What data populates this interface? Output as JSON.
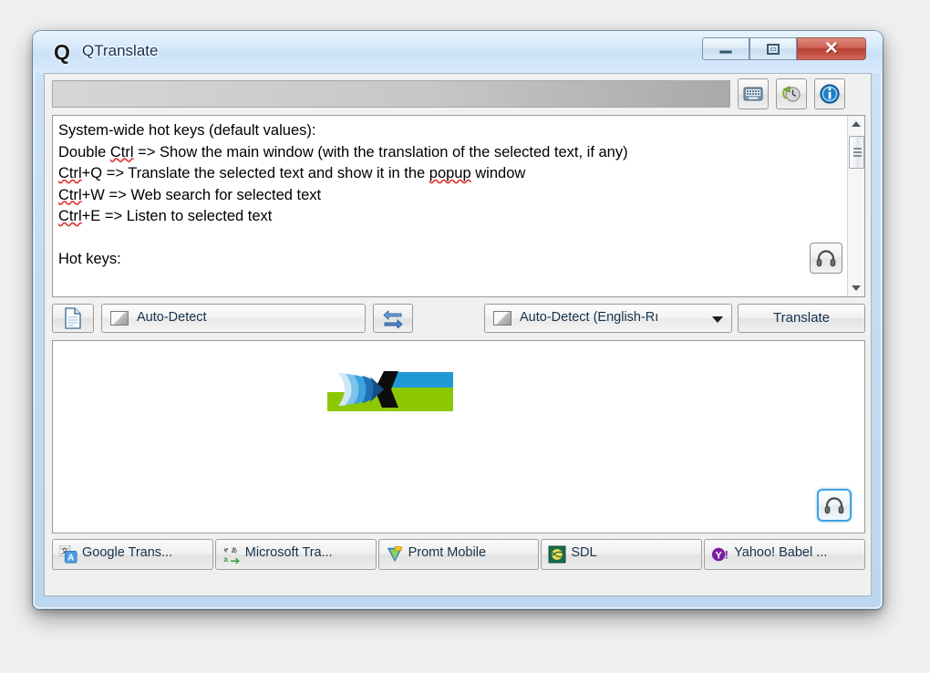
{
  "window": {
    "title": "QTranslate",
    "logo_glyph": "Q",
    "controls": {
      "minimize": "minimize-button",
      "maximize": "maximize-button",
      "close_glyph": "✕"
    }
  },
  "toolbar": {
    "search_value": "",
    "search_placeholder": "",
    "buttons": [
      {
        "name": "virtual-keyboard-icon",
        "title": "Virtual keyboard"
      },
      {
        "name": "history-icon",
        "title": "History"
      },
      {
        "name": "info-icon",
        "title": "Info"
      }
    ]
  },
  "input_pane": {
    "lines": [
      {
        "segments": [
          {
            "t": "System-wide hot keys (default values):",
            "sp": false
          }
        ]
      },
      {
        "segments": [
          {
            "t": "Double ",
            "sp": false
          },
          {
            "t": "Ctrl",
            "sp": true
          },
          {
            "t": " => Show the main window (with the translation of the selected text, if any)",
            "sp": false
          }
        ]
      },
      {
        "segments": [
          {
            "t": "Ctrl",
            "sp": true
          },
          {
            "t": "+Q => Translate the selected text and show it in the ",
            "sp": false
          },
          {
            "t": "popup",
            "sp": true
          },
          {
            "t": " window",
            "sp": false
          }
        ]
      },
      {
        "segments": [
          {
            "t": "Ctrl",
            "sp": true
          },
          {
            "t": "+W => Web search for selected text",
            "sp": false
          }
        ]
      },
      {
        "segments": [
          {
            "t": "Ctrl",
            "sp": true
          },
          {
            "t": "+E => Listen to selected text",
            "sp": false
          }
        ]
      },
      {
        "segments": [
          {
            "t": "",
            "sp": false
          }
        ]
      },
      {
        "segments": [
          {
            "t": "Hot keys:",
            "sp": false
          }
        ]
      }
    ],
    "listen_button": "listen-button"
  },
  "output_pane": {
    "text": "",
    "listen_button": "listen-button"
  },
  "lang_row": {
    "new_doc_button": "new-document-button",
    "source": {
      "label": "Auto-Detect",
      "has_arrow": false
    },
    "swap_button": "swap-languages-button",
    "target": {
      "label": "Auto-Detect (English-Rı",
      "has_arrow": true
    },
    "translate_label": "Translate"
  },
  "services": [
    {
      "label": "Google Trans...",
      "icon": "google-translate-icon"
    },
    {
      "label": "Microsoft Tra...",
      "icon": "microsoft-translator-icon"
    },
    {
      "label": "Promt Mobile",
      "icon": "promt-mobile-icon"
    },
    {
      "label": "SDL",
      "icon": "sdl-icon"
    },
    {
      "label": "Yahoo! Babel ...",
      "icon": "yahoo-babelfish-icon"
    }
  ],
  "colors": {
    "accent_blue": "#3fa3e0",
    "title_text": "#17334f",
    "close_red": "#b73f33",
    "logo_green": "#8cc800",
    "logo_blue": "#1f9ad6"
  }
}
